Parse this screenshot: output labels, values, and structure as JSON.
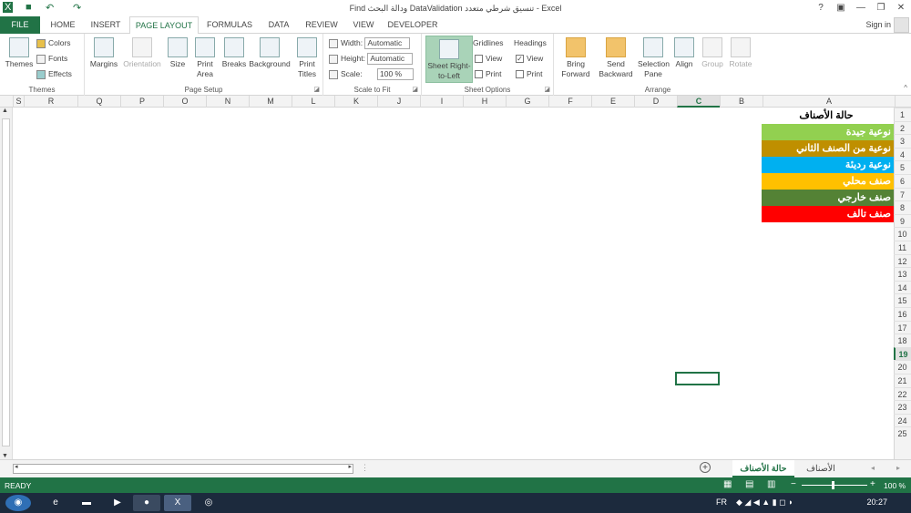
{
  "window": {
    "title": "Find ودالة البحث DataValidation تنسيق شرطي متعدد - Excel",
    "help": "?",
    "min": "—",
    "restore": "❐",
    "close": "✕",
    "signin": "Sign in"
  },
  "tabs": [
    "FILE",
    "HOME",
    "INSERT",
    "PAGE LAYOUT",
    "FORMULAS",
    "DATA",
    "REVIEW",
    "VIEW",
    "DEVELOPER"
  ],
  "ribbon": {
    "themes": {
      "label": "Themes",
      "themes": "Themes",
      "colors": "Colors",
      "fonts": "Fonts",
      "effects": "Effects"
    },
    "page_setup": {
      "label": "Page Setup",
      "margins": "Margins",
      "orientation": "Orientation",
      "size": "Size",
      "print_area_1": "Print",
      "print_area_2": "Area",
      "breaks": "Breaks",
      "background": "Background",
      "print_titles_1": "Print",
      "print_titles_2": "Titles"
    },
    "scale": {
      "label": "Scale to Fit",
      "width_label": "Width:",
      "width_value": "Automatic",
      "height_label": "Height:",
      "height_value": "Automatic",
      "scale_label": "Scale:",
      "scale_value": "100 %"
    },
    "sheet_options": {
      "label": "Sheet Options",
      "rtl_1": "Sheet Right-",
      "rtl_2": "to-Left",
      "gridlines": "Gridlines",
      "headings": "Headings",
      "view": "View",
      "print": "Print",
      "check": "✓"
    },
    "arrange": {
      "label": "Arrange",
      "bring_1": "Bring",
      "bring_2": "Forward",
      "send_1": "Send",
      "send_2": "Backward",
      "selection_1": "Selection",
      "selection_2": "Pane",
      "align": "Align",
      "group": "Group",
      "rotate": "Rotate"
    }
  },
  "columns": [
    "S",
    "R",
    "Q",
    "P",
    "O",
    "N",
    "M",
    "L",
    "K",
    "J",
    "I",
    "H",
    "G",
    "F",
    "E",
    "D",
    "C",
    "B",
    "A"
  ],
  "rows": [
    "1",
    "2",
    "3",
    "4",
    "5",
    "6",
    "7",
    "8",
    "9",
    "10",
    "11",
    "12",
    "13",
    "14",
    "15",
    "16",
    "17",
    "18",
    "19",
    "20",
    "21",
    "22",
    "23",
    "24",
    "25"
  ],
  "cells": [
    {
      "text": "حالة الأصناف",
      "color": "#ffffff"
    },
    {
      "text": "نوعية جيدة",
      "color": "#92d050"
    },
    {
      "text": "نوعية من الصنف الثاني",
      "color": "#bf8f00"
    },
    {
      "text": "نوعية رديئة",
      "color": "#00b0f0"
    },
    {
      "text": "صنف محلي",
      "color": "#ffc000"
    },
    {
      "text": "صنف خارجي",
      "color": "#548235"
    },
    {
      "text": "صنف تالف",
      "color": "#ff0000"
    }
  ],
  "sheets": {
    "active": "حالة الأصناف",
    "other": "الأصناف",
    "add": "+"
  },
  "status": {
    "ready": "READY",
    "zoom": "100 %",
    "minus": "−",
    "plus": "+"
  },
  "taskbar": {
    "lang": "FR",
    "time": "20:27"
  }
}
